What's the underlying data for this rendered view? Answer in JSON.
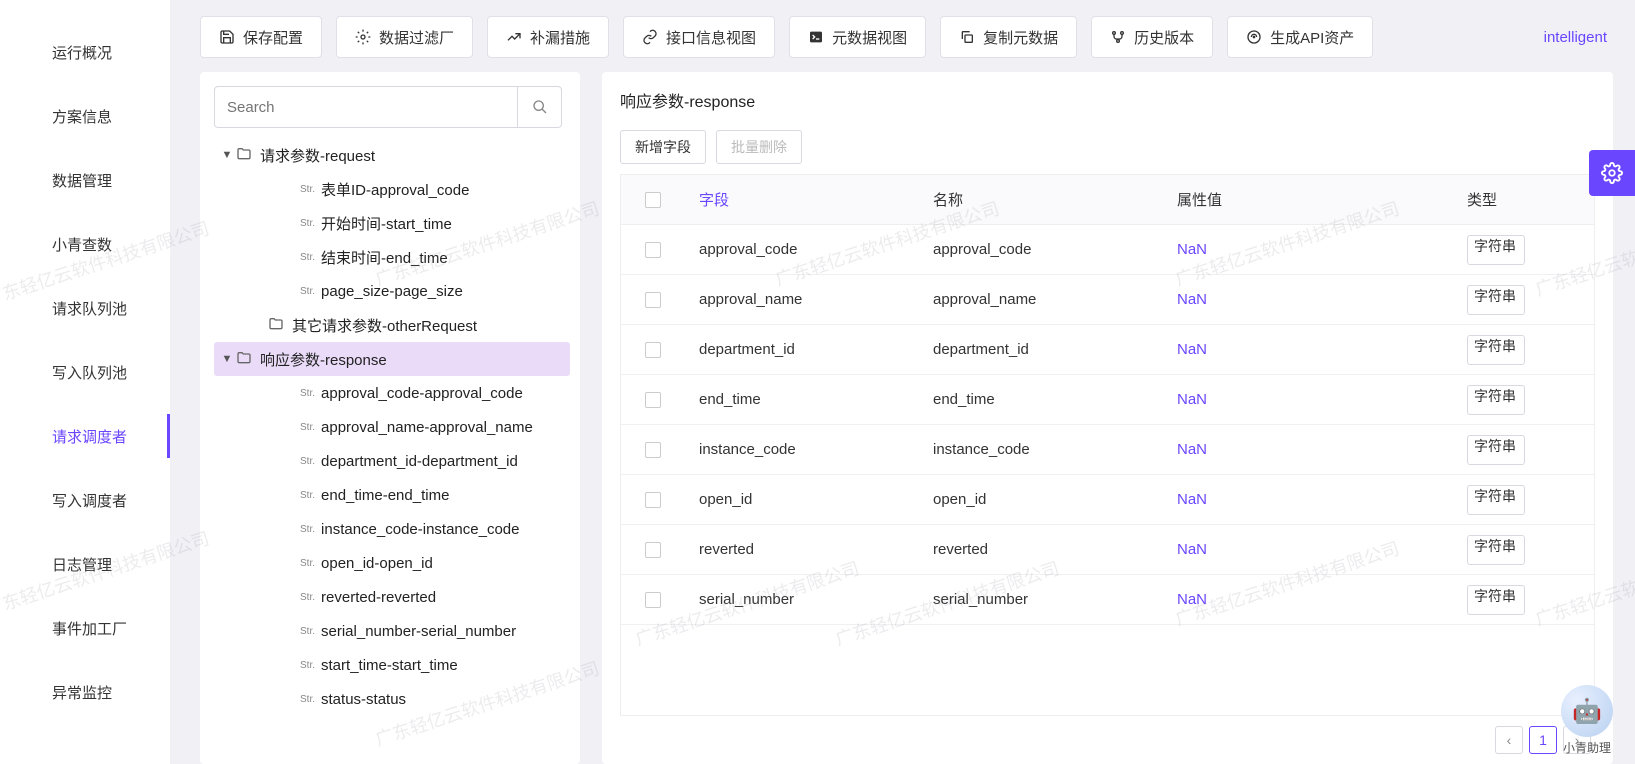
{
  "nav": {
    "items": [
      {
        "label": "运行概况"
      },
      {
        "label": "方案信息"
      },
      {
        "label": "数据管理"
      },
      {
        "label": "小青查数"
      },
      {
        "label": "请求队列池"
      },
      {
        "label": "写入队列池"
      },
      {
        "label": "请求调度者"
      },
      {
        "label": "写入调度者"
      },
      {
        "label": "日志管理"
      },
      {
        "label": "事件加工厂"
      },
      {
        "label": "异常监控"
      }
    ],
    "activeIndex": 6
  },
  "toolbar": {
    "buttons": [
      {
        "label": "保存配置",
        "icon": "save"
      },
      {
        "label": "数据过滤厂",
        "icon": "gear"
      },
      {
        "label": "补漏措施",
        "icon": "chart"
      },
      {
        "label": "接口信息视图",
        "icon": "link"
      },
      {
        "label": "元数据视图",
        "icon": "terminal"
      },
      {
        "label": "复制元数据",
        "icon": "copy"
      },
      {
        "label": "历史版本",
        "icon": "branch"
      },
      {
        "label": "生成API资产",
        "icon": "api"
      }
    ],
    "intelligent": "intelligent"
  },
  "tree": {
    "searchPlaceholder": "Search",
    "nodes": [
      {
        "indent": 0,
        "caret": "▼",
        "type": "folder",
        "label": "请求参数-request"
      },
      {
        "indent": 2,
        "type": "str",
        "label": "表单ID-approval_code"
      },
      {
        "indent": 2,
        "type": "str",
        "label": "开始时间-start_time"
      },
      {
        "indent": 2,
        "type": "str",
        "label": "结束时间-end_time"
      },
      {
        "indent": 2,
        "type": "str",
        "label": "page_size-page_size"
      },
      {
        "indent": 1,
        "type": "folder",
        "label": "其它请求参数-otherRequest"
      },
      {
        "indent": 0,
        "caret": "▼",
        "type": "folder",
        "label": "响应参数-response",
        "selected": true
      },
      {
        "indent": 2,
        "type": "str",
        "label": "approval_code-approval_code"
      },
      {
        "indent": 2,
        "type": "str",
        "label": "approval_name-approval_name"
      },
      {
        "indent": 2,
        "type": "str",
        "label": "department_id-department_id"
      },
      {
        "indent": 2,
        "type": "str",
        "label": "end_time-end_time"
      },
      {
        "indent": 2,
        "type": "str",
        "label": "instance_code-instance_code"
      },
      {
        "indent": 2,
        "type": "str",
        "label": "open_id-open_id"
      },
      {
        "indent": 2,
        "type": "str",
        "label": "reverted-reverted"
      },
      {
        "indent": 2,
        "type": "str",
        "label": "serial_number-serial_number"
      },
      {
        "indent": 2,
        "type": "str",
        "label": "start_time-start_time"
      },
      {
        "indent": 2,
        "type": "str",
        "label": "status-status"
      }
    ]
  },
  "content": {
    "title": "响应参数-response",
    "addField": "新增字段",
    "batchDelete": "批量删除",
    "headers": {
      "field": "字段",
      "name": "名称",
      "attr": "属性值",
      "type": "类型"
    },
    "typeOption": "字符串",
    "rows": [
      {
        "field": "approval_code",
        "name": "approval_code",
        "attr": "NaN"
      },
      {
        "field": "approval_name",
        "name": "approval_name",
        "attr": "NaN"
      },
      {
        "field": "department_id",
        "name": "department_id",
        "attr": "NaN"
      },
      {
        "field": "end_time",
        "name": "end_time",
        "attr": "NaN"
      },
      {
        "field": "instance_code",
        "name": "instance_code",
        "attr": "NaN"
      },
      {
        "field": "open_id",
        "name": "open_id",
        "attr": "NaN"
      },
      {
        "field": "reverted",
        "name": "reverted",
        "attr": "NaN"
      },
      {
        "field": "serial_number",
        "name": "serial_number",
        "attr": "NaN"
      }
    ],
    "page": "1"
  },
  "assistant": {
    "label": "小青助理"
  },
  "watermarkText": "广东轻亿云软件科技有限公司"
}
